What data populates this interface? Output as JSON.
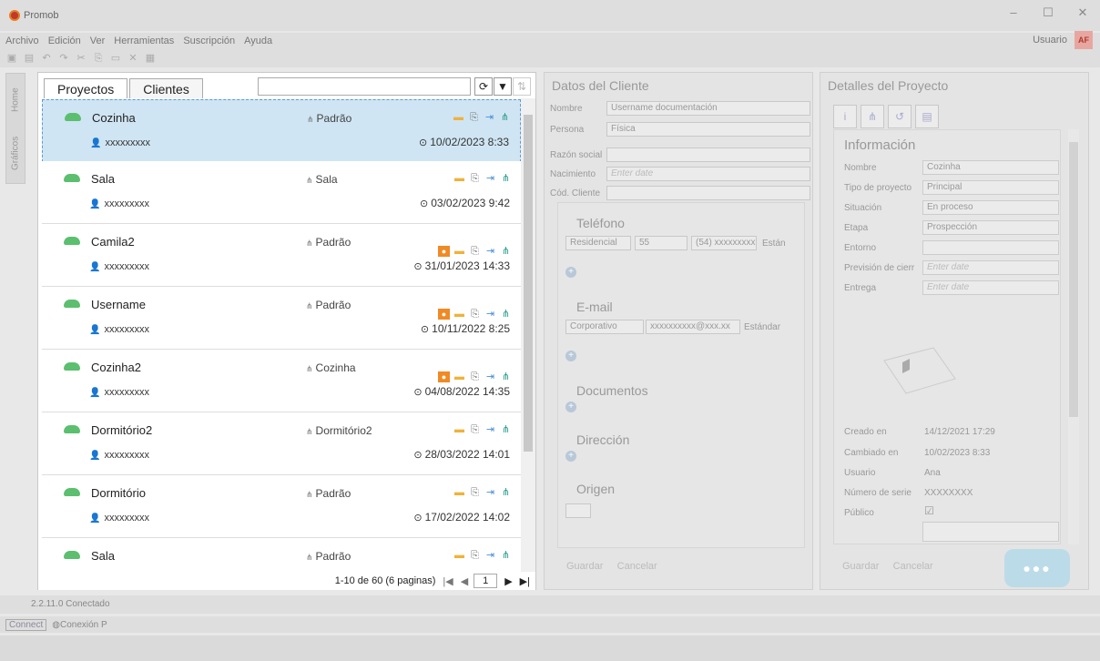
{
  "app": {
    "title": "Promob"
  },
  "menu": [
    "Archivo",
    "Edición",
    "Ver",
    "Herramientas",
    "Suscripción",
    "Ayuda"
  ],
  "user": {
    "label": "Usuario",
    "initials": "AF"
  },
  "side_tabs": [
    "Home",
    "Gráficos"
  ],
  "left": {
    "tabs": [
      "Proyectos",
      "Clientes"
    ],
    "search_placeholder": "",
    "projects": [
      {
        "name": "Cozinha",
        "env": "Padrão",
        "user": "xxxxxxxxx",
        "date": "10/02/2023 8:33",
        "person": false
      },
      {
        "name": "Sala",
        "env": "Sala",
        "user": "xxxxxxxxx",
        "date": "03/02/2023 9:42",
        "person": false
      },
      {
        "name": "Camila2",
        "env": "Padrão",
        "user": "xxxxxxxxx",
        "date": "31/01/2023 14:33",
        "person": true
      },
      {
        "name": "Username",
        "env": "Padrão",
        "user": "xxxxxxxxx",
        "date": "10/11/2022 8:25",
        "person": true
      },
      {
        "name": "Cozinha2",
        "env": "Cozinha",
        "user": "xxxxxxxxx",
        "date": "04/08/2022 14:35",
        "person": true
      },
      {
        "name": "Dormitório2",
        "env": "Dormitório2",
        "user": "xxxxxxxxx",
        "date": "28/03/2022 14:01",
        "person": false
      },
      {
        "name": "Dormitório",
        "env": "Padrão",
        "user": "xxxxxxxxx",
        "date": "17/02/2022 14:02",
        "person": false
      },
      {
        "name": "Sala",
        "env": "Padrão",
        "user": "",
        "date": "",
        "person": false
      }
    ],
    "pager": {
      "summary": "1-10 de 60 (6 paginas)",
      "page": "1"
    }
  },
  "client": {
    "title": "Datos del Cliente",
    "nombre_label": "Nombre",
    "nombre_value": "Username documentación",
    "persona_label": "Persona",
    "persona_value": "Física",
    "razon_label": "Razón social",
    "nacimiento_label": "Nacimiento",
    "nacimiento_placeholder": "Enter date",
    "cod_label": "Cód. Cliente",
    "telefono": "Teléfono",
    "tel_type": "Residencial",
    "tel_code": "55",
    "tel_number": "(54) xxxxxxxxx",
    "tel_std": "Están",
    "email": "E-mail",
    "email_type": "Corporativo",
    "email_value": "xxxxxxxxxx@xxx.xx",
    "email_std": "Estándar",
    "documentos": "Documentos",
    "direccion": "Dirección",
    "origen": "Origen",
    "guardar": "Guardar",
    "cancelar": "Cancelar"
  },
  "project": {
    "title": "Detalles del Proyecto",
    "section": "Información",
    "nombre_label": "Nombre",
    "nombre_value": "Cozinha",
    "tipo_label": "Tipo de proyecto",
    "tipo_value": "Principal",
    "situacion_label": "Situación",
    "situacion_value": "En proceso",
    "etapa_label": "Etapa",
    "etapa_value": "Prospección",
    "entorno_label": "Entorno",
    "prevision_label": "Previsión de cierr",
    "prevision_placeholder": "Enter date",
    "entrega_label": "Entrega",
    "entrega_placeholder": "Enter date",
    "creado_label": "Creado en",
    "creado_value": "14/12/2021 17:29",
    "cambiado_label": "Cambiado en",
    "cambiado_value": "10/02/2023 8:33",
    "usuario_label": "Usuario",
    "usuario_value": "Ana",
    "serie_label": "Número de serie",
    "serie_value": "XXXXXXXX",
    "publico_label": "Público",
    "guardar": "Guardar",
    "cancelar": "Cancelar"
  },
  "status": {
    "version": "2.2.11.0 Conectado",
    "connect": "Connect",
    "conexion": "Conexión P"
  }
}
